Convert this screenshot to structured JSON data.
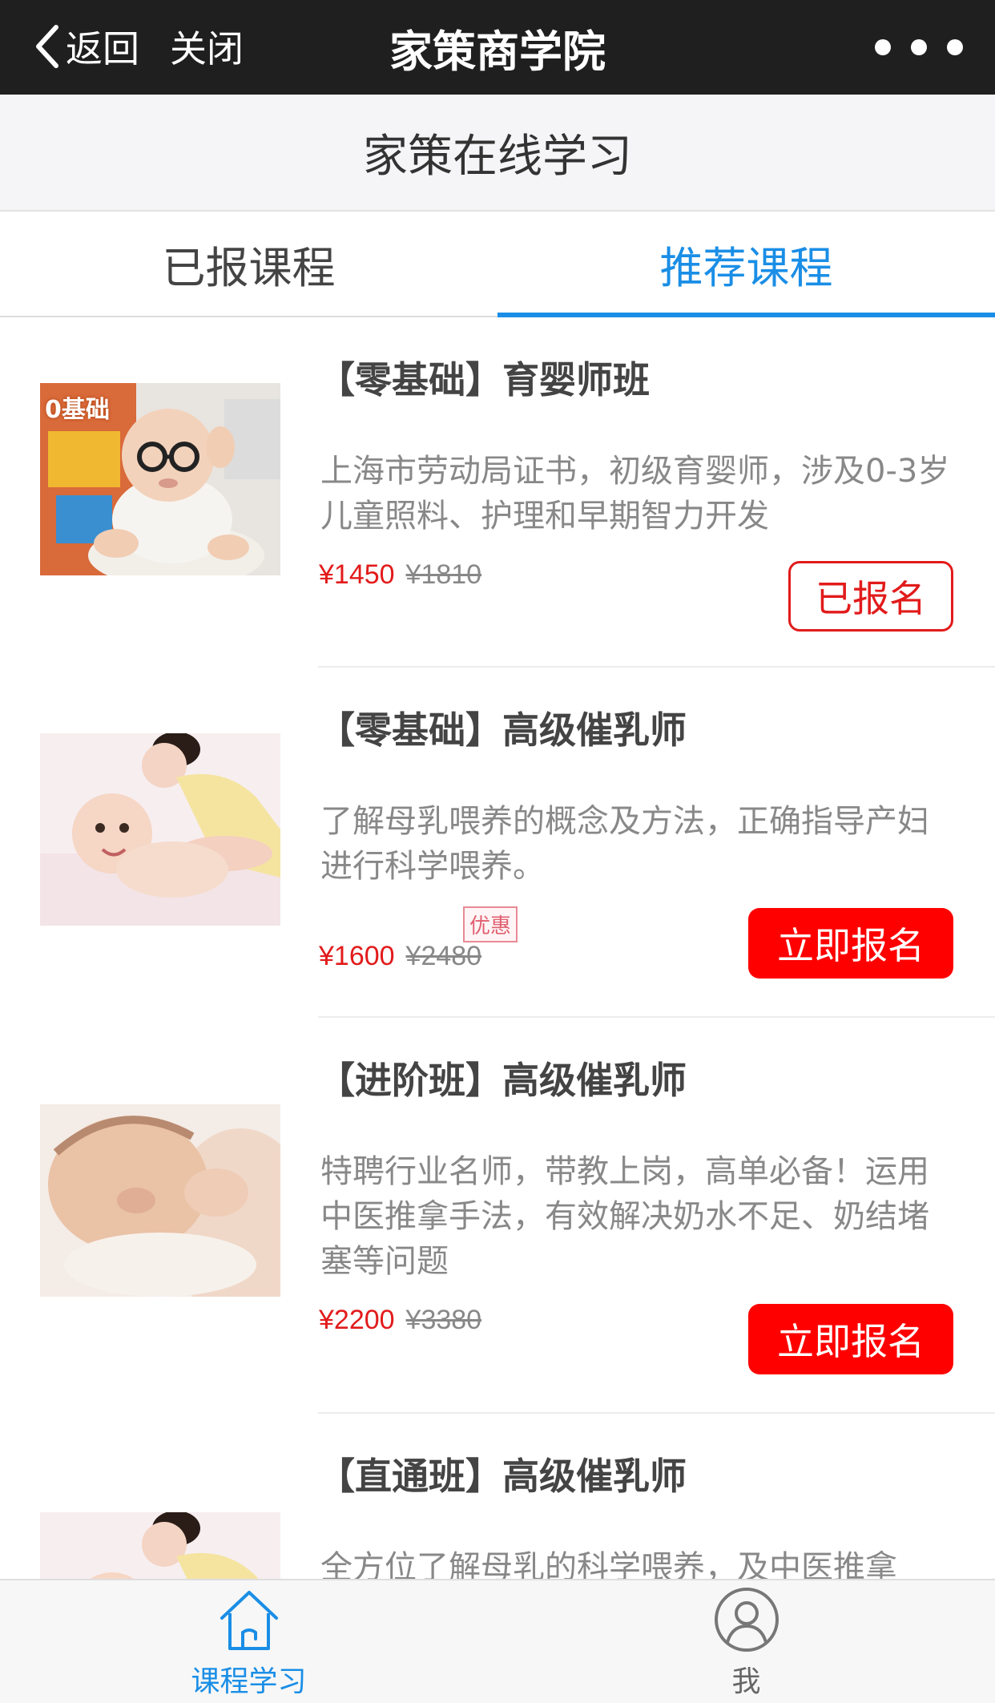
{
  "navbar": {
    "back_label": "返回",
    "close_label": "关闭",
    "title": "家策商学院"
  },
  "header": {
    "title": "家策在线学习"
  },
  "tabs": [
    {
      "label": "已报课程",
      "active": false
    },
    {
      "label": "推荐课程",
      "active": true
    }
  ],
  "courses": [
    {
      "title": "【零基础】育婴师班",
      "description": "上海市劳动局证书，初级育婴师，涉及0-3岁儿童照料、护理和早期智力开发",
      "price": "¥1450",
      "original_price": "¥1810",
      "button_label": "已报名",
      "button_state": "enrolled",
      "thumb_badge": "0基础",
      "thumb_icon": "baby-with-glasses-photo"
    },
    {
      "title": "【零基础】高级催乳师",
      "description": "了解母乳喂养的概念及方法，正确指导产妇进行科学喂养。",
      "price": "¥1600",
      "original_price": "¥2480",
      "promo_tag": "优惠",
      "button_label": "立即报名",
      "button_state": "available",
      "thumb_icon": "mother-and-baby-photo"
    },
    {
      "title": "【进阶班】高级催乳师",
      "description": "特聘行业名师，带教上岗，高单必备！运用中医推拿手法，有效解决奶水不足、奶结堵塞等问题",
      "price": "¥2200",
      "original_price": "¥3380",
      "button_label": "立即报名",
      "button_state": "available",
      "thumb_icon": "nursing-baby-photo"
    },
    {
      "title": "【直通班】高级催乳师",
      "description": "全方位了解母乳的科学喂养，及中医推拿",
      "thumb_icon": "mother-and-baby-photo"
    }
  ],
  "tabbar": [
    {
      "label": "课程学习",
      "icon": "home-icon",
      "active": true
    },
    {
      "label": "我",
      "icon": "user-icon",
      "active": false
    }
  ],
  "colors": {
    "accent": "#1a8ee6",
    "price_red": "#e21b1b",
    "button_red": "#ff0000",
    "navbar_bg": "#1f1f1f"
  }
}
